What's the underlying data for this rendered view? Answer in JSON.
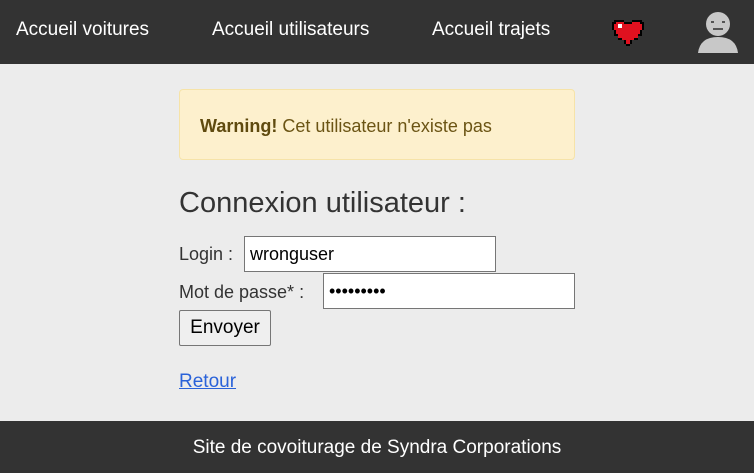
{
  "nav": {
    "cars": "Accueil voitures",
    "users": "Accueil utilisateurs",
    "trips": "Accueil trajets",
    "favorites_icon": "heart-icon",
    "account_icon": "user-avatar-icon"
  },
  "alert": {
    "strong": "Warning!",
    "message": " Cet utilisateur n'existe pas"
  },
  "form": {
    "title": "Connexion utilisateur :",
    "login_label": "Login :",
    "login_value": "wronguser",
    "password_label": "Mot de passe* :",
    "password_value": "wrongpass",
    "submit_label": "Envoyer"
  },
  "back_link": "Retour",
  "footer": "Site de covoiturage de Syndra Corporations",
  "colors": {
    "nav_bg": "#333333",
    "page_bg": "#ececec",
    "alert_bg": "#fdf0cd",
    "link": "#2a62d9",
    "heart": "#e0111f"
  }
}
